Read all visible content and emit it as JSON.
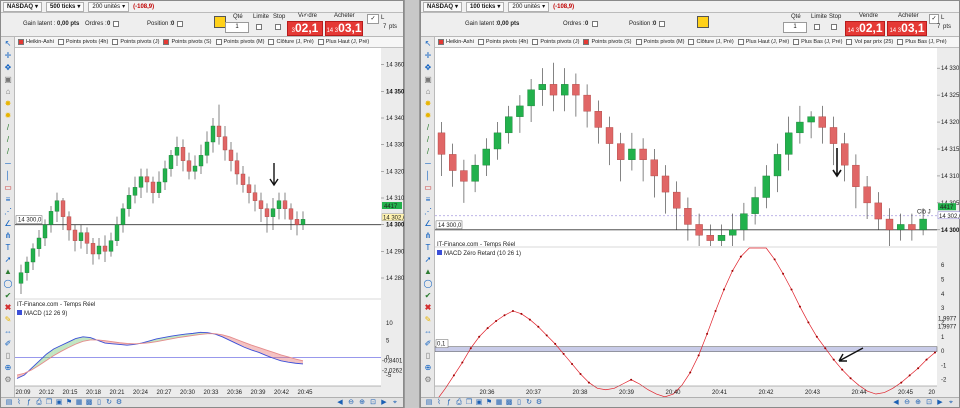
{
  "left": {
    "instrument": "NASDAQ",
    "ticks": "500 ticks",
    "units": "200 unités",
    "pnl": "(-108,9)",
    "gain_label": "Gain latent :",
    "gain_value": "0,00 pts",
    "orders_label": "Ordres :",
    "orders_value": "0",
    "position_label": "Position :",
    "position_value": "0",
    "qty_label": "Qté",
    "qty_value": "1",
    "limit_label": "Limite",
    "stop_label": "Stop",
    "sell_label": "Vendre",
    "sell_price_small": "14 3",
    "sell_price_big": "02,1",
    "buy_label": "Acheter",
    "buy_price_small": "14 3",
    "buy_price_big": "03,1",
    "pts_value": "7",
    "pts_label": "pts",
    "val_900": "900",
    "val_900_label": "pts",
    "l_label": "L",
    "sg_label": "Sg",
    "indicators": [
      {
        "label": "Heikin-Ashi",
        "color": "#e53935"
      },
      {
        "label": "Points pivots (4h)",
        "color": ""
      },
      {
        "label": "Points pivots (J)",
        "color": ""
      },
      {
        "label": "Points pivots (S)",
        "color": "#e53935"
      },
      {
        "label": "Points pivots (M)",
        "color": ""
      },
      {
        "label": "Clôture (J, Pré)",
        "color": ""
      },
      {
        "label": "Plus Haut (J, Pré)",
        "color": ""
      }
    ],
    "price_axis": [
      "14 360",
      "14 350",
      "14 340",
      "14 330",
      "14 320",
      "14 310",
      "14 300",
      "14 290",
      "14 280"
    ],
    "price_tag": "14 302,6",
    "volume_tag": "4417",
    "level_tag": "14 300,0",
    "source": "IT-Finance.com - Temps Réel",
    "macd_label": "MACD (12 26 9)",
    "macd_axis": [
      "10",
      "5",
      "0",
      "-5"
    ],
    "macd_tag1": "-0,8401",
    "macd_tag2": "-2,0262",
    "time_axis": [
      "20:09",
      "20:12",
      "20:15",
      "20:18",
      "20:21",
      "20:24",
      "20:27",
      "20:30",
      "20:33",
      "20:36",
      "20:39",
      "20:42",
      "20:45"
    ]
  },
  "right": {
    "instrument": "NASDAQ",
    "ticks": "100 ticks",
    "units": "200 unités",
    "pnl": "(-108,9)",
    "gain_label": "Gain latent :",
    "gain_value": "0,00 pts",
    "orders_label": "Ordres :",
    "orders_value": "0",
    "position_label": "Position :",
    "position_value": "0",
    "qty_label": "Qté",
    "qty_value": "1",
    "limit_label": "Limite",
    "stop_label": "Stop",
    "sell_label": "Vendre",
    "sell_price_small": "14 3",
    "sell_price_big": "02,1",
    "buy_label": "Acheter",
    "buy_price_small": "14 3",
    "buy_price_big": "03,1",
    "pts_value": "7",
    "pts_label": "pts",
    "val_900": "900",
    "val_900_label": "pts",
    "l_label": "L",
    "sg_label": "Sg",
    "indicators": [
      {
        "label": "Heikin-Ashi",
        "color": "#e53935"
      },
      {
        "label": "Points pivots (4h)",
        "color": ""
      },
      {
        "label": "Points pivots (J)",
        "color": ""
      },
      {
        "label": "Points pivots (S)",
        "color": "#e53935"
      },
      {
        "label": "Points pivots (M)",
        "color": ""
      },
      {
        "label": "Clôture (J, Pré)",
        "color": ""
      },
      {
        "label": "Plus Haut (J, Pré)",
        "color": ""
      },
      {
        "label": "Plus Bas (J, Pré)",
        "color": ""
      },
      {
        "label": "Vol par prix (25)",
        "color": ""
      },
      {
        "label": "Plus Bas (J, Pré)",
        "color": ""
      }
    ],
    "price_axis": [
      "14 330",
      "14 325",
      "14 320",
      "14 315",
      "14 310",
      "14 305",
      "14 300"
    ],
    "price_tag": "14 302,6",
    "volume_tag": "4417",
    "level_tag": "14 300,0",
    "clo_tag": "Clô J",
    "source": "IT-Finance.com - Temps Réel",
    "macd_label": "MACD Zéro Retard (10 26 1)",
    "macd_axis": [
      "6",
      "5",
      "4",
      "3",
      "2",
      "1",
      "0",
      "-1",
      "-2"
    ],
    "macd_tag1": "1,9977",
    "macd_tag2": "1,9977",
    "macd_tag3": "0,1",
    "time_axis": [
      "20:36",
      "20:37",
      "20:38",
      "20:39",
      "20:40",
      "20:41",
      "20:42",
      "20:43",
      "20:44",
      "20:45"
    ],
    "time_axis_end": "20"
  },
  "colors": {
    "bull": "#22b14c",
    "bear": "#e06666",
    "macd_line": "#3b4fd8",
    "signal_line": "#e58c8c",
    "zero_macd": "#e0202a"
  },
  "icons": [
    "chevron-down-icon",
    "check-icon",
    "settings-icon",
    "cross-icon",
    "zoom-in-icon",
    "zoom-out-icon",
    "refresh-icon",
    "print-icon",
    "pin-icon"
  ]
}
